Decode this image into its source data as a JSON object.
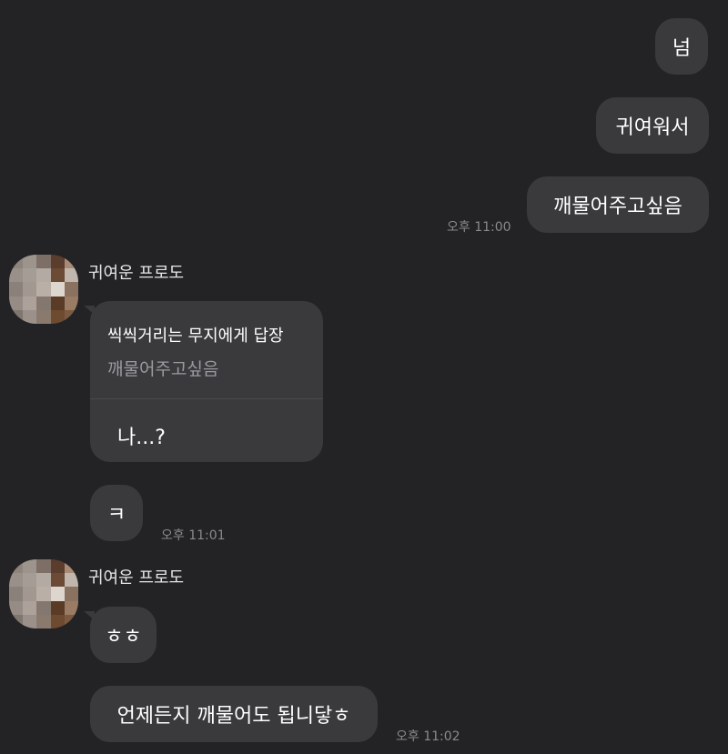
{
  "messages": {
    "sent_1": "넘",
    "sent_2": "귀여워서",
    "sent_3": "깨물어주고싶음",
    "sent_time": "오후 11:00",
    "sender_name_1": "귀여운 프로도",
    "reply_label": "씩씩거리는 무지에게 답장",
    "reply_quote": "깨물어주고싶음",
    "reply_text": "나...?",
    "recv_1": "ㅋ",
    "recv_time_1": "오후 11:01",
    "sender_name_2": "귀여운 프로도",
    "recv_2": "ㅎㅎ",
    "recv_3": "언제든지 깨물어도 됩니닿ㅎ",
    "recv_time_2": "오후 11:02"
  },
  "colors": {
    "background": "#232326",
    "bubble": "#3a3a3d",
    "timestamp": "#8a8a8e"
  },
  "icons": {
    "avatar": "pixelated-profile-avatar"
  }
}
